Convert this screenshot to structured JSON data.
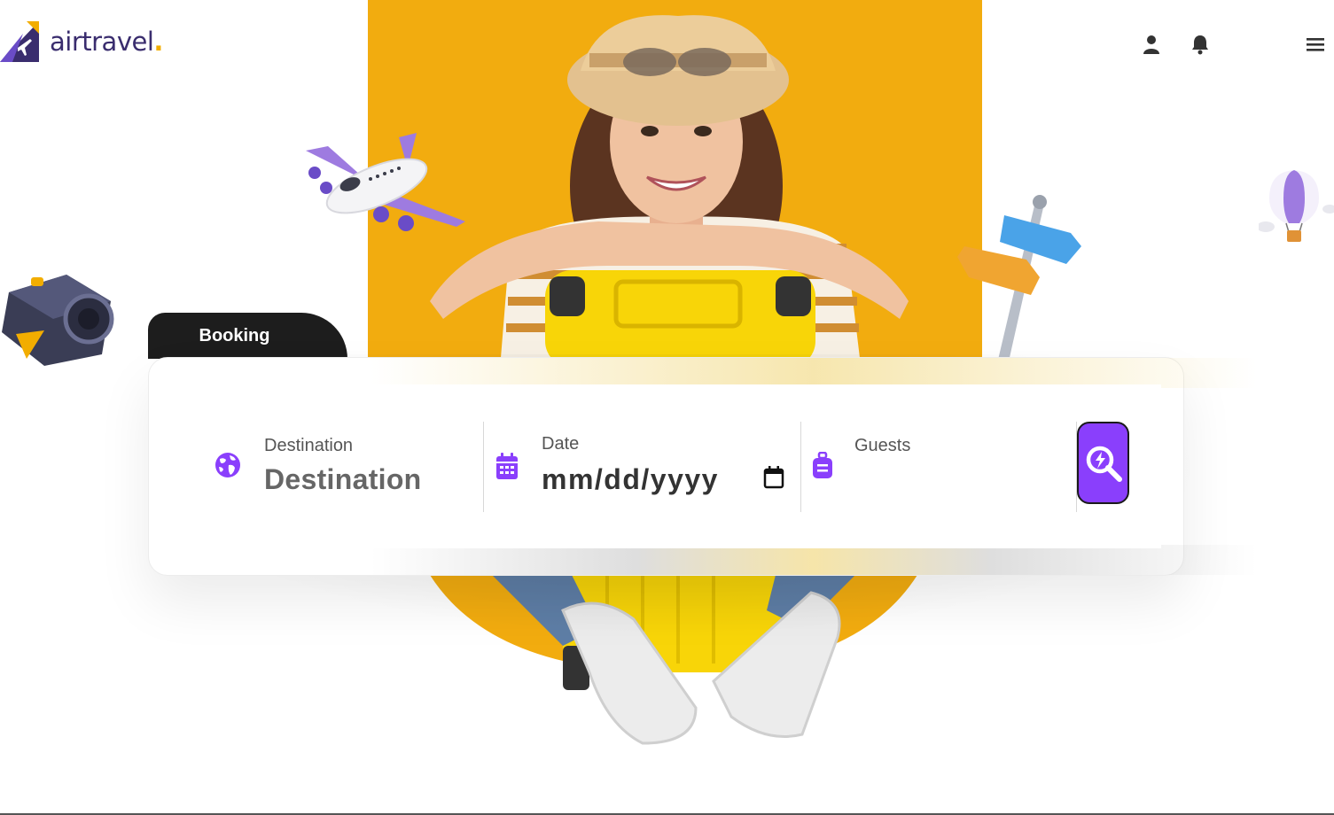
{
  "brand": {
    "name": "airtravel",
    "dot": "."
  },
  "header": {
    "icons": [
      "user-icon",
      "bell-icon",
      "menu-icon"
    ]
  },
  "booking": {
    "tab_label": "Booking",
    "fields": {
      "destination": {
        "label": "Destination",
        "placeholder": "Destination",
        "icon": "globe-icon"
      },
      "date": {
        "label": "Date",
        "placeholder": "mm/dd/yyyy",
        "icon": "calendar-icon"
      },
      "guests": {
        "label": "Guests",
        "icon": "luggage-icon"
      }
    },
    "search_icon": "search-icon"
  },
  "colors": {
    "accent": "#8a3ffc",
    "brand_yellow": "#f2ac0f",
    "brand_dark": "#3a2d6e"
  }
}
